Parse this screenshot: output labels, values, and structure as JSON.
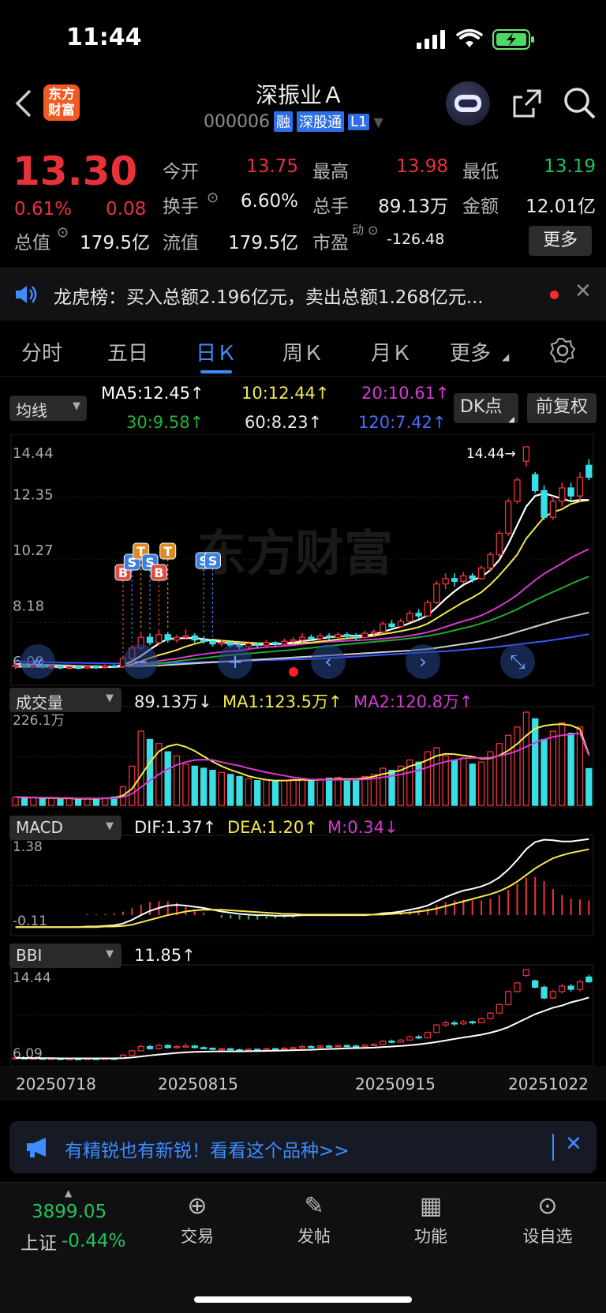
{
  "status": {
    "time": "11:44"
  },
  "header": {
    "logo_line1": "东方",
    "logo_line2": "财富",
    "stock_name": "深振业Ａ",
    "stock_code": "000006",
    "badge_rong": "融",
    "badge_sgt": "深股通",
    "badge_level": "L1"
  },
  "quote": {
    "price": "13.30",
    "change_pct": "0.61%",
    "change": "0.08",
    "open_label": "今开",
    "open": "13.75",
    "high_label": "最高",
    "high": "13.98",
    "low_label": "最低",
    "low": "13.19",
    "turnover_label": "换手",
    "turnover": "6.60%",
    "volume_label": "总手",
    "volume": "89.13万",
    "amount_label": "金额",
    "amount": "12.01亿",
    "mcap_label": "总值",
    "mcap": "179.5亿",
    "float_label": "流值",
    "float": "179.5亿",
    "pe_label": "市盈",
    "pe_sup": "动",
    "pe": "-126.48",
    "more_button": "更多"
  },
  "notice": {
    "text": "龙虎榜：买入总额2.196亿元，卖出总额1.268亿元..."
  },
  "tabs": [
    {
      "label": "分时"
    },
    {
      "label": "五日"
    },
    {
      "label": "日Ｋ"
    },
    {
      "label": "周Ｋ"
    },
    {
      "label": "月Ｋ"
    },
    {
      "label": "更多"
    }
  ],
  "ma_bar": {
    "selector": "均线",
    "ma5": "MA5:12.45↑",
    "ma10": "10:12.44↑",
    "ma20": "20:10.61↑",
    "ma30": "30:9.58↑",
    "ma60": "60:8.23↑",
    "ma120": "120:7.42↑",
    "dk_button": "DK点",
    "fq_button": "前复权",
    "colors": {
      "ma5": "#ffffff",
      "ma10": "#f5e94b",
      "ma20": "#d63bd0",
      "ma30": "#22a832",
      "ma60": "#cfcfcf",
      "ma120": "#3c55ff"
    }
  },
  "kchart": {
    "y_labels": [
      "14.44",
      "12.35",
      "10.27",
      "8.18",
      "6.09"
    ],
    "max_note": "14.44",
    "watermark": "东方财富",
    "signals": [
      "B",
      "S",
      "T",
      "S",
      "B",
      "T",
      "S",
      "S"
    ]
  },
  "volume_panel": {
    "selector": "成交量",
    "vol": "89.13万↓",
    "ma1": "MA1:123.5万↑",
    "ma2": "MA2:120.8万↑",
    "y_top": "226.1万"
  },
  "macd_panel": {
    "selector": "MACD",
    "dif": "DIF:1.37↑",
    "dea": "DEA:1.20↑",
    "m": "M:0.34↓",
    "y_top": "1.38",
    "y_bottom": "-0.11"
  },
  "bbi_panel": {
    "selector": "BBI",
    "value": "11.85↑",
    "y_top": "14.44",
    "y_bottom": "6.09"
  },
  "x_dates": [
    "20250718",
    "20250815",
    "20250915",
    "20251022"
  ],
  "ad_banner": {
    "text": "有精锐也有新锐！看看这个品种>>"
  },
  "bottom_nav": {
    "index_value": "3899.05",
    "index_name": "上证",
    "index_change": "-0.44%",
    "items": [
      {
        "label": "交易",
        "icon": "yen-icon"
      },
      {
        "label": "发帖",
        "icon": "edit-icon"
      },
      {
        "label": "功能",
        "icon": "grid-icon"
      },
      {
        "label": "设自选",
        "icon": "more-icon"
      }
    ]
  },
  "chart_data": {
    "type": "candlestick",
    "price_axis": {
      "ylim": [
        6.09,
        14.44
      ],
      "ticks": [
        "14.44",
        "12.35",
        "10.27",
        "8.18",
        "6.09"
      ]
    },
    "x_ticks": [
      "20250718",
      "20250815",
      "20250915",
      "20251022"
    ],
    "candles": [
      [
        6.2,
        6.25,
        6.1,
        6.3
      ],
      [
        6.25,
        6.2,
        6.15,
        6.3
      ],
      [
        6.2,
        6.22,
        6.15,
        6.28
      ],
      [
        6.22,
        6.18,
        6.12,
        6.28
      ],
      [
        6.18,
        6.2,
        6.1,
        6.26
      ],
      [
        6.2,
        6.15,
        6.1,
        6.24
      ],
      [
        6.15,
        6.18,
        6.09,
        6.22
      ],
      [
        6.18,
        6.15,
        6.1,
        6.22
      ],
      [
        6.15,
        6.2,
        6.1,
        6.25
      ],
      [
        6.2,
        6.18,
        6.12,
        6.25
      ],
      [
        6.18,
        6.22,
        6.12,
        6.28
      ],
      [
        6.22,
        6.2,
        6.15,
        6.28
      ],
      [
        6.2,
        6.5,
        6.15,
        6.6
      ],
      [
        6.5,
        6.9,
        6.45,
        7.0
      ],
      [
        6.9,
        7.3,
        6.85,
        7.5
      ],
      [
        7.3,
        7.1,
        7.0,
        7.45
      ],
      [
        7.1,
        7.4,
        7.0,
        7.6
      ],
      [
        7.4,
        7.2,
        7.1,
        7.5
      ],
      [
        7.2,
        7.3,
        7.1,
        7.4
      ],
      [
        7.3,
        7.35,
        7.2,
        7.6
      ],
      [
        7.35,
        7.2,
        7.1,
        7.45
      ],
      [
        7.2,
        7.15,
        7.05,
        7.35
      ],
      [
        7.15,
        7.05,
        6.95,
        7.2
      ],
      [
        7.05,
        7.1,
        6.95,
        7.2
      ],
      [
        7.1,
        7.0,
        6.9,
        7.15
      ],
      [
        7.0,
        6.95,
        6.85,
        7.1
      ],
      [
        6.95,
        7.05,
        6.9,
        7.15
      ],
      [
        7.05,
        7.0,
        6.9,
        7.1
      ],
      [
        7.0,
        7.1,
        6.95,
        7.2
      ],
      [
        7.1,
        7.05,
        6.95,
        7.15
      ],
      [
        7.05,
        7.15,
        7.0,
        7.25
      ],
      [
        7.15,
        7.2,
        7.05,
        7.3
      ],
      [
        7.2,
        7.3,
        7.1,
        7.45
      ],
      [
        7.3,
        7.25,
        7.15,
        7.4
      ],
      [
        7.25,
        7.35,
        7.15,
        7.45
      ],
      [
        7.35,
        7.3,
        7.2,
        7.45
      ],
      [
        7.3,
        7.4,
        7.25,
        7.5
      ],
      [
        7.4,
        7.35,
        7.25,
        7.5
      ],
      [
        7.35,
        7.3,
        7.2,
        7.45
      ],
      [
        7.3,
        7.45,
        7.25,
        7.55
      ],
      [
        7.45,
        7.5,
        7.35,
        7.6
      ],
      [
        7.5,
        7.8,
        7.45,
        7.9
      ],
      [
        7.8,
        7.7,
        7.6,
        7.95
      ],
      [
        7.7,
        7.9,
        7.65,
        8.0
      ],
      [
        7.9,
        8.2,
        7.85,
        8.3
      ],
      [
        8.2,
        8.1,
        8.0,
        8.35
      ],
      [
        8.1,
        8.6,
        8.05,
        8.7
      ],
      [
        8.6,
        9.3,
        8.55,
        9.4
      ],
      [
        9.3,
        9.5,
        9.1,
        9.7
      ],
      [
        9.5,
        9.4,
        9.2,
        9.7
      ],
      [
        9.4,
        9.6,
        9.3,
        9.75
      ],
      [
        9.6,
        9.5,
        9.35,
        9.7
      ],
      [
        9.5,
        9.9,
        9.45,
        10.0
      ],
      [
        9.9,
        10.4,
        9.8,
        10.5
      ],
      [
        10.4,
        11.2,
        10.3,
        11.3
      ],
      [
        11.2,
        12.4,
        11.1,
        12.5
      ],
      [
        12.4,
        13.2,
        12.3,
        13.3
      ],
      [
        13.9,
        14.44,
        13.7,
        14.44
      ],
      [
        13.4,
        12.8,
        12.7,
        13.5
      ],
      [
        12.8,
        11.8,
        11.7,
        13.0
      ],
      [
        11.8,
        12.4,
        11.7,
        12.6
      ],
      [
        12.4,
        12.9,
        12.2,
        13.1
      ],
      [
        12.9,
        12.6,
        12.4,
        13.1
      ],
      [
        12.6,
        13.3,
        12.4,
        13.5
      ],
      [
        13.75,
        13.3,
        13.19,
        13.98
      ]
    ],
    "series": [
      {
        "name": "MA5",
        "values": [
          6.2,
          6.2,
          6.2,
          6.2,
          6.2,
          6.18,
          6.18,
          6.17,
          6.17,
          6.17,
          6.18,
          6.19,
          6.26,
          6.4,
          6.6,
          6.84,
          7.06,
          7.24,
          7.26,
          7.27,
          7.27,
          7.23,
          7.18,
          7.11,
          7.08,
          7.04,
          7.03,
          7.01,
          7.04,
          7.04,
          7.07,
          7.1,
          7.16,
          7.19,
          7.25,
          7.3,
          7.33,
          7.35,
          7.36,
          7.37,
          7.4,
          7.51,
          7.6,
          7.7,
          7.83,
          7.96,
          8.12,
          8.42,
          8.74,
          9.02,
          9.27,
          9.44,
          9.56,
          9.82,
          10.2,
          10.8,
          11.5,
          12.2,
          12.6,
          12.7,
          12.6,
          12.5,
          12.4,
          12.45,
          12.45
        ]
      },
      {
        "name": "10",
        "values": [
          6.2,
          6.2,
          6.2,
          6.2,
          6.2,
          6.19,
          6.19,
          6.18,
          6.18,
          6.18,
          6.18,
          6.18,
          6.21,
          6.28,
          6.4,
          6.52,
          6.63,
          6.72,
          6.82,
          6.95,
          7.05,
          7.14,
          7.21,
          7.18,
          7.15,
          7.12,
          7.1,
          7.08,
          7.07,
          7.06,
          7.06,
          7.06,
          7.09,
          7.1,
          7.14,
          7.18,
          7.22,
          7.26,
          7.28,
          7.31,
          7.35,
          7.42,
          7.47,
          7.53,
          7.6,
          7.68,
          7.81,
          8.01,
          8.22,
          8.42,
          8.62,
          8.79,
          8.99,
          9.28,
          9.62,
          10.0,
          10.4,
          11.0,
          11.4,
          11.8,
          12.0,
          12.1,
          12.3,
          12.4,
          12.44
        ]
      },
      {
        "name": "20",
        "values": [
          6.2,
          6.2,
          6.2,
          6.2,
          6.2,
          6.2,
          6.2,
          6.19,
          6.19,
          6.19,
          6.19,
          6.19,
          6.2,
          6.23,
          6.29,
          6.35,
          6.41,
          6.46,
          6.5,
          6.56,
          6.62,
          6.67,
          6.71,
          6.75,
          6.78,
          6.8,
          6.86,
          6.9,
          6.93,
          6.95,
          6.98,
          7.0,
          7.05,
          7.08,
          7.11,
          7.13,
          7.15,
          7.17,
          7.18,
          7.2,
          7.22,
          7.25,
          7.28,
          7.31,
          7.36,
          7.42,
          7.49,
          7.58,
          7.69,
          7.8,
          7.91,
          8.0,
          8.12,
          8.28,
          8.46,
          8.66,
          8.89,
          9.17,
          9.44,
          9.68,
          9.88,
          10.07,
          10.28,
          10.45,
          10.61
        ]
      },
      {
        "name": "30",
        "values": [
          6.22,
          6.22,
          6.21,
          6.21,
          6.21,
          6.2,
          6.2,
          6.2,
          6.2,
          6.2,
          6.2,
          6.2,
          6.2,
          6.22,
          6.25,
          6.28,
          6.32,
          6.36,
          6.4,
          6.44,
          6.48,
          6.52,
          6.56,
          6.6,
          6.63,
          6.66,
          6.69,
          6.72,
          6.75,
          6.78,
          6.8,
          6.83,
          6.87,
          6.9,
          6.94,
          6.97,
          7.01,
          7.04,
          7.07,
          7.1,
          7.13,
          7.16,
          7.19,
          7.22,
          7.26,
          7.3,
          7.35,
          7.41,
          7.48,
          7.56,
          7.64,
          7.72,
          7.82,
          7.93,
          8.06,
          8.2,
          8.35,
          8.52,
          8.69,
          8.85,
          9.0,
          9.15,
          9.3,
          9.45,
          9.58
        ]
      },
      {
        "name": "60",
        "values": [
          6.3,
          6.29,
          6.28,
          6.27,
          6.26,
          6.25,
          6.24,
          6.23,
          6.22,
          6.22,
          6.21,
          6.21,
          6.21,
          6.21,
          6.22,
          6.23,
          6.24,
          6.26,
          6.28,
          6.3,
          6.32,
          6.34,
          6.36,
          6.38,
          6.4,
          6.42,
          6.44,
          6.46,
          6.48,
          6.5,
          6.52,
          6.54,
          6.56,
          6.58,
          6.6,
          6.62,
          6.64,
          6.66,
          6.68,
          6.7,
          6.72,
          6.74,
          6.76,
          6.78,
          6.8,
          6.83,
          6.86,
          6.9,
          6.95,
          7.0,
          7.05,
          7.1,
          7.16,
          7.23,
          7.31,
          7.4,
          7.5,
          7.6,
          7.7,
          7.8,
          7.9,
          7.99,
          8.07,
          8.15,
          8.23
        ]
      },
      {
        "name": "120",
        "values": [
          6.4,
          6.39,
          6.38,
          6.37,
          6.36,
          6.35,
          6.34,
          6.34,
          6.33,
          6.33,
          6.32,
          6.32,
          6.32,
          6.32,
          6.32,
          6.32,
          6.33,
          6.33,
          6.34,
          6.35,
          6.36,
          6.37,
          6.38,
          6.39,
          6.4,
          6.41,
          6.42,
          6.43,
          6.44,
          6.45,
          6.46,
          6.47,
          6.48,
          6.49,
          6.5,
          6.52,
          6.54,
          6.56,
          6.58,
          6.6,
          6.62,
          6.64,
          6.66,
          6.68,
          6.7,
          6.72,
          6.74,
          6.76,
          6.78,
          6.8,
          6.83,
          6.86,
          6.89,
          6.92,
          6.95,
          6.99,
          7.03,
          7.07,
          7.11,
          7.15,
          7.2,
          7.25,
          7.3,
          7.36,
          7.42
        ]
      }
    ],
    "volume": {
      "ylim": [
        0,
        226.1
      ],
      "values": [
        20,
        18,
        19,
        17,
        18,
        16,
        17,
        15,
        16,
        17,
        18,
        20,
        45,
        95,
        180,
        160,
        150,
        130,
        120,
        100,
        95,
        90,
        85,
        80,
        75,
        70,
        65,
        60,
        62,
        58,
        60,
        63,
        66,
        62,
        64,
        66,
        68,
        64,
        62,
        70,
        75,
        90,
        85,
        95,
        110,
        105,
        130,
        140,
        120,
        110,
        115,
        100,
        105,
        130,
        150,
        170,
        190,
        226.1,
        210,
        160,
        180,
        200,
        175,
        190,
        89.13
      ],
      "ma1": [
        20,
        19,
        19,
        18,
        18,
        17,
        17,
        16,
        16,
        16,
        17,
        18,
        24,
        40,
        72,
        104,
        131,
        143,
        148,
        142,
        132,
        119,
        106,
        95,
        86,
        79,
        71,
        66,
        62,
        60,
        60,
        61,
        62,
        61,
        62,
        63,
        64,
        64,
        64,
        66,
        70,
        76,
        80,
        85,
        95,
        101,
        110,
        120,
        125,
        124,
        121,
        118,
        113,
        114,
        121,
        133,
        149,
        169,
        186,
        193,
        196,
        197,
        194,
        185,
        123.5
      ],
      "ma2": [
        20,
        20,
        19,
        19,
        19,
        18,
        18,
        17,
        17,
        17,
        17,
        17,
        20,
        28,
        44,
        60,
        75,
        88,
        98,
        105,
        110,
        111,
        110,
        105,
        100,
        96,
        90,
        85,
        80,
        76,
        72,
        68,
        65,
        63,
        62,
        62,
        62,
        62,
        62,
        63,
        65,
        68,
        71,
        75,
        80,
        85,
        92,
        100,
        106,
        110,
        114,
        115,
        115,
        116,
        120,
        125,
        132,
        142,
        152,
        160,
        166,
        170,
        172,
        175,
        120.8
      ]
    },
    "macd": {
      "ylim": [
        -0.11,
        1.38
      ],
      "dif": [
        -0.1,
        -0.1,
        -0.1,
        -0.1,
        -0.1,
        -0.1,
        -0.1,
        -0.1,
        -0.09,
        -0.09,
        -0.08,
        -0.07,
        -0.04,
        0.02,
        0.1,
        0.17,
        0.22,
        0.26,
        0.27,
        0.26,
        0.24,
        0.22,
        0.19,
        0.16,
        0.14,
        0.12,
        0.11,
        0.1,
        0.1,
        0.09,
        0.09,
        0.09,
        0.1,
        0.1,
        0.1,
        0.1,
        0.1,
        0.1,
        0.1,
        0.1,
        0.11,
        0.13,
        0.14,
        0.16,
        0.19,
        0.22,
        0.26,
        0.33,
        0.4,
        0.46,
        0.51,
        0.54,
        0.58,
        0.64,
        0.73,
        0.86,
        1.02,
        1.2,
        1.32,
        1.36,
        1.35,
        1.33,
        1.33,
        1.35,
        1.37
      ],
      "dea": [
        -0.1,
        -0.1,
        -0.1,
        -0.1,
        -0.1,
        -0.1,
        -0.1,
        -0.1,
        -0.1,
        -0.1,
        -0.09,
        -0.09,
        -0.08,
        -0.06,
        -0.02,
        0.02,
        0.06,
        0.1,
        0.13,
        0.16,
        0.18,
        0.19,
        0.19,
        0.19,
        0.18,
        0.17,
        0.16,
        0.15,
        0.14,
        0.13,
        0.12,
        0.12,
        0.11,
        0.11,
        0.11,
        0.11,
        0.11,
        0.11,
        0.11,
        0.11,
        0.11,
        0.11,
        0.12,
        0.13,
        0.14,
        0.16,
        0.18,
        0.21,
        0.25,
        0.29,
        0.33,
        0.37,
        0.41,
        0.45,
        0.5,
        0.57,
        0.66,
        0.77,
        0.88,
        0.97,
        1.05,
        1.1,
        1.14,
        1.17,
        1.2
      ]
    },
    "bbi": {
      "ylim": [
        6.09,
        14.44
      ],
      "values": [
        6.25,
        6.24,
        6.23,
        6.22,
        6.22,
        6.2,
        6.2,
        6.2,
        6.2,
        6.2,
        6.2,
        6.2,
        6.22,
        6.28,
        6.37,
        6.47,
        6.56,
        6.63,
        6.7,
        6.76,
        6.8,
        6.82,
        6.84,
        6.85,
        6.85,
        6.85,
        6.87,
        6.88,
        6.9,
        6.91,
        6.93,
        6.95,
        6.98,
        7.0,
        7.04,
        7.07,
        7.1,
        7.13,
        7.15,
        7.17,
        7.2,
        7.25,
        7.3,
        7.35,
        7.42,
        7.5,
        7.6,
        7.72,
        7.86,
        8.0,
        8.14,
        8.26,
        8.4,
        8.58,
        8.8,
        9.1,
        9.5,
        9.9,
        10.3,
        10.6,
        10.9,
        11.1,
        11.4,
        11.6,
        11.85
      ]
    }
  }
}
